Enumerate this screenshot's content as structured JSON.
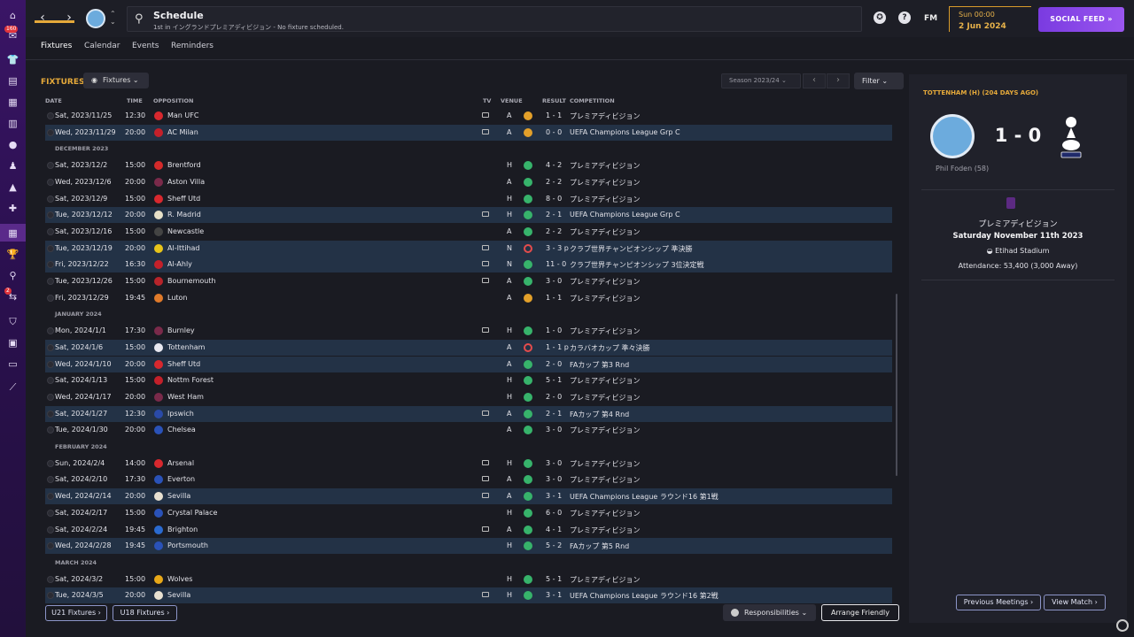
{
  "header": {
    "title": "Schedule",
    "subtitle": "1st in イングランドプレミアディビジョン - No fixture scheduled.",
    "fm_label": "FM",
    "date_line1": "Sun 00:00",
    "date_line2": "2 Jun 2024",
    "social_feed": "SOCIAL FEED",
    "rail_badge_1": "160",
    "rail_badge_2": "2"
  },
  "tabs": [
    "Fixtures",
    "Calendar",
    "Events",
    "Reminders"
  ],
  "fixtures": {
    "heading": "FIXTURES",
    "view_button": "Fixtures",
    "season": "Season 2023/24",
    "filter": "Filter",
    "columns": {
      "date": "DATE",
      "time": "TIME",
      "opposition": "OPPOSITION",
      "tv": "TV",
      "venue": "VENUE",
      "result": "RESULT",
      "competition": "COMPETITION"
    },
    "rows": [
      {
        "kind": "match",
        "date": "Sat, 2023/11/25",
        "time": "12:30",
        "opp": "Man UFC",
        "crest": "#d8282e",
        "tv": true,
        "venue": "A",
        "outcome": "draw",
        "result": "1 - 1",
        "comp": "プレミアディビジョン",
        "hl": false
      },
      {
        "kind": "match",
        "date": "Wed, 2023/11/29",
        "time": "20:00",
        "opp": "AC Milan",
        "crest": "#c4202a",
        "tv": true,
        "venue": "A",
        "outcome": "draw",
        "result": "0 - 0",
        "comp": "UEFA Champions League Grp C",
        "hl": true
      },
      {
        "kind": "month",
        "label": "DECEMBER 2023"
      },
      {
        "kind": "match",
        "date": "Sat, 2023/12/2",
        "time": "15:00",
        "opp": "Brentford",
        "crest": "#d42a2a",
        "tv": false,
        "venue": "H",
        "outcome": "win",
        "result": "4 - 2",
        "comp": "プレミアディビジョン",
        "hl": false
      },
      {
        "kind": "match",
        "date": "Wed, 2023/12/6",
        "time": "20:00",
        "opp": "Aston Villa",
        "crest": "#7a2a4a",
        "tv": false,
        "venue": "A",
        "outcome": "win",
        "result": "2 - 2",
        "comp": "プレミアディビジョン",
        "hl": false
      },
      {
        "kind": "match",
        "date": "Sat, 2023/12/9",
        "time": "15:00",
        "opp": "Sheff Utd",
        "crest": "#d8282e",
        "tv": false,
        "venue": "H",
        "outcome": "win",
        "result": "8 - 0",
        "comp": "プレミアディビジョン",
        "hl": false
      },
      {
        "kind": "match",
        "date": "Tue, 2023/12/12",
        "time": "20:00",
        "opp": "R. Madrid",
        "crest": "#e6e0c8",
        "tv": true,
        "venue": "H",
        "outcome": "win",
        "result": "2 - 1",
        "comp": "UEFA Champions League Grp C",
        "hl": true
      },
      {
        "kind": "match",
        "date": "Sat, 2023/12/16",
        "time": "15:00",
        "opp": "Newcastle",
        "crest": "#444444",
        "tv": false,
        "venue": "A",
        "outcome": "win",
        "result": "2 - 2",
        "comp": "プレミアディビジョン",
        "hl": false
      },
      {
        "kind": "match",
        "date": "Tue, 2023/12/19",
        "time": "20:00",
        "opp": "Al-Ittihad",
        "crest": "#e8c41a",
        "tv": true,
        "venue": "N",
        "outcome": "loss",
        "result": "3 - 3 p",
        "comp": "クラブ世界チャンピオンシップ 準決勝",
        "hl": true
      },
      {
        "kind": "match",
        "date": "Fri, 2023/12/22",
        "time": "16:30",
        "opp": "Al-Ahly",
        "crest": "#c4202a",
        "tv": true,
        "venue": "N",
        "outcome": "win",
        "result": "11 - 0",
        "comp": "クラブ世界チャンピオンシップ 3位決定戦",
        "hl": true
      },
      {
        "kind": "match",
        "date": "Tue, 2023/12/26",
        "time": "15:00",
        "opp": "Bournemouth",
        "crest": "#b8242a",
        "tv": true,
        "venue": "A",
        "outcome": "win",
        "result": "3 - 0",
        "comp": "プレミアディビジョン",
        "hl": false
      },
      {
        "kind": "match",
        "date": "Fri, 2023/12/29",
        "time": "19:45",
        "opp": "Luton",
        "crest": "#e07a2a",
        "tv": false,
        "venue": "A",
        "outcome": "draw",
        "result": "1 - 1",
        "comp": "プレミアディビジョン",
        "hl": false
      },
      {
        "kind": "month",
        "label": "JANUARY 2024"
      },
      {
        "kind": "match",
        "date": "Mon, 2024/1/1",
        "time": "17:30",
        "opp": "Burnley",
        "crest": "#7a2a4a",
        "tv": true,
        "venue": "H",
        "outcome": "win",
        "result": "1 - 0",
        "comp": "プレミアディビジョン",
        "hl": false
      },
      {
        "kind": "match",
        "date": "Sat, 2024/1/6",
        "time": "15:00",
        "opp": "Tottenham",
        "crest": "#e8e8f0",
        "tv": false,
        "venue": "A",
        "outcome": "loss",
        "result": "1 - 1 p",
        "comp": "カラバオカップ 準々決勝",
        "hl": true
      },
      {
        "kind": "match",
        "date": "Wed, 2024/1/10",
        "time": "20:00",
        "opp": "Sheff Utd",
        "crest": "#d8282e",
        "tv": false,
        "venue": "A",
        "outcome": "win",
        "result": "2 - 0",
        "comp": "FAカップ 第3 Rnd",
        "hl": true
      },
      {
        "kind": "match",
        "date": "Sat, 2024/1/13",
        "time": "15:00",
        "opp": "Nottm Forest",
        "crest": "#c4202a",
        "tv": false,
        "venue": "H",
        "outcome": "win",
        "result": "5 - 1",
        "comp": "プレミアディビジョン",
        "hl": false
      },
      {
        "kind": "match",
        "date": "Wed, 2024/1/17",
        "time": "20:00",
        "opp": "West Ham",
        "crest": "#7a2a4a",
        "tv": false,
        "venue": "H",
        "outcome": "win",
        "result": "2 - 0",
        "comp": "プレミアディビジョン",
        "hl": false
      },
      {
        "kind": "match",
        "date": "Sat, 2024/1/27",
        "time": "12:30",
        "opp": "Ipswich",
        "crest": "#2a4aa8",
        "tv": true,
        "venue": "A",
        "outcome": "win",
        "result": "2 - 1",
        "comp": "FAカップ 第4 Rnd",
        "hl": true
      },
      {
        "kind": "match",
        "date": "Tue, 2024/1/30",
        "time": "20:00",
        "opp": "Chelsea",
        "crest": "#2a52b8",
        "tv": false,
        "venue": "A",
        "outcome": "win",
        "result": "3 - 0",
        "comp": "プレミアディビジョン",
        "hl": false
      },
      {
        "kind": "month",
        "label": "FEBRUARY 2024"
      },
      {
        "kind": "match",
        "date": "Sun, 2024/2/4",
        "time": "14:00",
        "opp": "Arsenal",
        "crest": "#d8282e",
        "tv": true,
        "venue": "H",
        "outcome": "win",
        "result": "3 - 0",
        "comp": "プレミアディビジョン",
        "hl": false
      },
      {
        "kind": "match",
        "date": "Sat, 2024/2/10",
        "time": "17:30",
        "opp": "Everton",
        "crest": "#2a52b8",
        "tv": true,
        "venue": "A",
        "outcome": "win",
        "result": "3 - 0",
        "comp": "プレミアディビジョン",
        "hl": false
      },
      {
        "kind": "match",
        "date": "Wed, 2024/2/14",
        "time": "20:00",
        "opp": "Sevilla",
        "crest": "#e8e0d0",
        "tv": true,
        "venue": "A",
        "outcome": "win",
        "result": "3 - 1",
        "comp": "UEFA Champions League ラウンド16 第1戦",
        "hl": true
      },
      {
        "kind": "match",
        "date": "Sat, 2024/2/17",
        "time": "15:00",
        "opp": "Crystal Palace",
        "crest": "#2a52b8",
        "tv": false,
        "venue": "H",
        "outcome": "win",
        "result": "6 - 0",
        "comp": "プレミアディビジョン",
        "hl": false
      },
      {
        "kind": "match",
        "date": "Sat, 2024/2/24",
        "time": "19:45",
        "opp": "Brighton",
        "crest": "#2a6ad0",
        "tv": true,
        "venue": "A",
        "outcome": "win",
        "result": "4 - 1",
        "comp": "プレミアディビジョン",
        "hl": false
      },
      {
        "kind": "match",
        "date": "Wed, 2024/2/28",
        "time": "19:45",
        "opp": "Portsmouth",
        "crest": "#2a52b8",
        "tv": false,
        "venue": "H",
        "outcome": "win",
        "result": "5 - 2",
        "comp": "FAカップ 第5 Rnd",
        "hl": true
      },
      {
        "kind": "month",
        "label": "MARCH 2024"
      },
      {
        "kind": "match",
        "date": "Sat, 2024/3/2",
        "time": "15:00",
        "opp": "Wolves",
        "crest": "#e8a818",
        "tv": false,
        "venue": "H",
        "outcome": "win",
        "result": "5 - 1",
        "comp": "プレミアディビジョン",
        "hl": false
      },
      {
        "kind": "match",
        "date": "Tue, 2024/3/5",
        "time": "20:00",
        "opp": "Sevilla",
        "crest": "#e8e0d0",
        "tv": true,
        "venue": "H",
        "outcome": "win",
        "result": "3 - 1",
        "comp": "UEFA Champions League ラウンド16 第2戦",
        "hl": true
      }
    ],
    "u21_button": "U21 Fixtures",
    "u18_button": "U18 Fixtures",
    "responsibilities": "Responsibilities",
    "arrange_friendly": "Arrange Friendly"
  },
  "match_panel": {
    "title": "TOTTENHAM (H) (204 DAYS AGO)",
    "score": "1 - 0",
    "scorer": "Phil Foden (58)",
    "competition": "プレミアディビジョン",
    "date": "Saturday November 11th 2023",
    "stadium": "Etihad Stadium",
    "attendance": "Attendance: 53,400 (3,000 Away)",
    "previous_meetings": "Previous Meetings",
    "view_match": "View Match"
  }
}
